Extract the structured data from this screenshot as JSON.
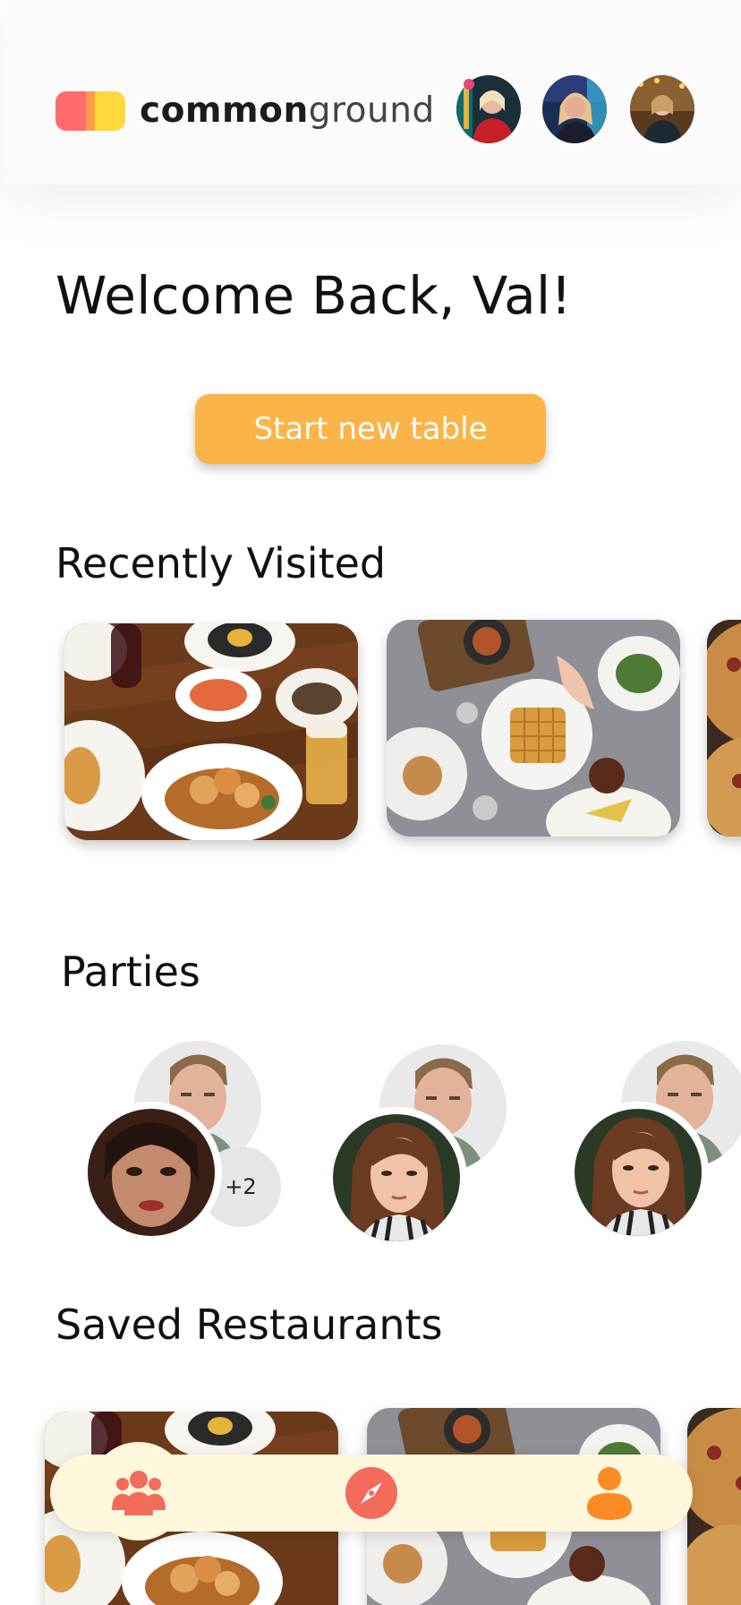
{
  "app": {
    "logo_bold": "common",
    "logo_light": "ground",
    "colors": {
      "accent": "#fbb447",
      "logo_red": "#ff6b6b",
      "logo_yellow": "#ffd93a",
      "nav_icon": "#f26b5b",
      "nav_bg": "#fff7dc",
      "notification": "#e8457c"
    }
  },
  "header": {
    "avatars": [
      {
        "name": "friend-avatar-1",
        "has_notification": true
      },
      {
        "name": "friend-avatar-2",
        "has_notification": false
      },
      {
        "name": "friend-avatar-3",
        "has_notification": false
      }
    ]
  },
  "welcome": {
    "text": "Welcome Back, Val!"
  },
  "actions": {
    "start_table_label": "Start new table"
  },
  "recently_visited": {
    "title": "Recently Visited",
    "items": [
      "restaurant-photo-1",
      "restaurant-photo-2",
      "restaurant-photo-3"
    ]
  },
  "parties": {
    "title": "Parties",
    "items": [
      {
        "extra_count": "+2"
      },
      {
        "extra_count": ""
      },
      {
        "extra_count": ""
      }
    ]
  },
  "saved_restaurants": {
    "title": "Saved Restaurants",
    "items": [
      "restaurant-photo-1",
      "restaurant-photo-2",
      "restaurant-photo-3"
    ]
  },
  "bottom_nav": {
    "items": [
      {
        "icon": "group-icon",
        "active": true
      },
      {
        "icon": "compass-icon",
        "active": false
      },
      {
        "icon": "user-icon",
        "active": false
      }
    ]
  }
}
